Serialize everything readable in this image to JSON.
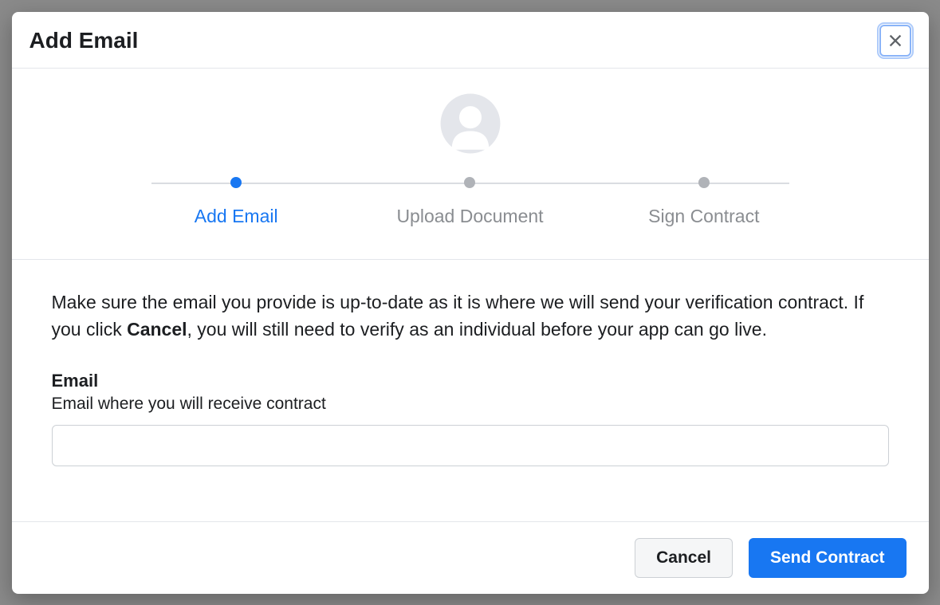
{
  "modal": {
    "title": "Add Email",
    "steps": [
      {
        "label": "Add Email",
        "active": true
      },
      {
        "label": "Upload Document",
        "active": false
      },
      {
        "label": "Sign Contract",
        "active": false
      }
    ],
    "body": {
      "text_before_bold": "Make sure the email you provide is up-to-date as it is where we will send your verification contract. If you click ",
      "bold_word": "Cancel",
      "text_after_bold": ", you will still need to verify as an individual before your app can go live."
    },
    "field": {
      "label": "Email",
      "help": "Email where you will receive contract",
      "value": "",
      "placeholder": ""
    },
    "buttons": {
      "cancel": "Cancel",
      "submit": "Send Contract"
    }
  }
}
